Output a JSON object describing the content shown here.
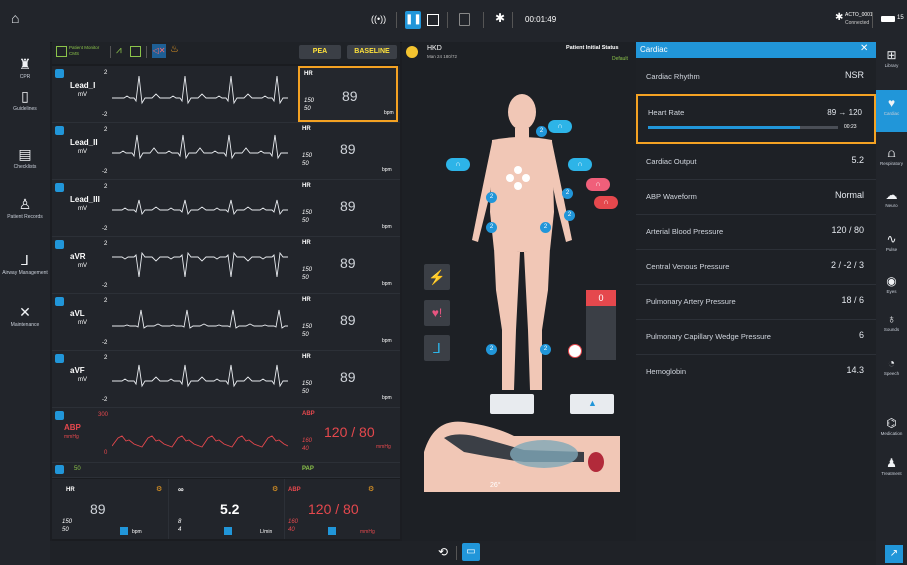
{
  "topbar": {
    "timer": "00:01:49",
    "bluetooth_device": "ACTO_0001",
    "bluetooth_status": "Connected",
    "battery_label": "15"
  },
  "left_nav": [
    {
      "label": "CPR",
      "icon": "person-cpr-icon"
    },
    {
      "label": "Guidelines",
      "icon": "book-icon"
    },
    {
      "label": "Checklists",
      "icon": "clipboard-icon"
    },
    {
      "label": "Patient Records",
      "icon": "user-record-icon"
    },
    {
      "label": "Airway Management",
      "icon": "airway-icon"
    },
    {
      "label": "Maintenance",
      "icon": "tools-icon"
    }
  ],
  "monitor": {
    "header": {
      "title": "Patient Monitor",
      "subtitle": "CMS",
      "pea_label": "PEA",
      "baseline_label": "BASELINE"
    },
    "leads": [
      {
        "name": "Lead_I",
        "unit": "mV",
        "top": "2",
        "bottom": "-2",
        "vital_label": "HR",
        "vital_value": "89",
        "hi": "150",
        "lo": "50",
        "vital_unit": "bpm"
      },
      {
        "name": "Lead_II",
        "unit": "mV",
        "top": "2",
        "bottom": "-2",
        "vital_label": "HR",
        "vital_value": "89",
        "hi": "150",
        "lo": "50",
        "vital_unit": "bpm"
      },
      {
        "name": "Lead_III",
        "unit": "mV",
        "top": "2",
        "bottom": "-2",
        "vital_label": "HR",
        "vital_value": "89",
        "hi": "150",
        "lo": "50",
        "vital_unit": "bpm"
      },
      {
        "name": "aVR",
        "unit": "mV",
        "top": "2",
        "bottom": "-2",
        "vital_label": "HR",
        "vital_value": "89",
        "hi": "150",
        "lo": "50",
        "vital_unit": "bpm"
      },
      {
        "name": "aVL",
        "unit": "mV",
        "top": "2",
        "bottom": "-2",
        "vital_label": "HR",
        "vital_value": "89",
        "hi": "150",
        "lo": "50",
        "vital_unit": "bpm"
      },
      {
        "name": "aVF",
        "unit": "mV",
        "top": "2",
        "bottom": "-2",
        "vital_label": "HR",
        "vital_value": "89",
        "hi": "150",
        "lo": "50",
        "vital_unit": "bpm"
      }
    ],
    "abp": {
      "name": "ABP",
      "unit": "mmHg",
      "top": "300",
      "bottom": "0",
      "vital_label": "ABP",
      "vital_value": "120 / 80",
      "hi": "160",
      "lo": "40",
      "vital_unit": "mmHg"
    },
    "pap": {
      "top": "50",
      "vital_label": "PAP"
    },
    "footer": {
      "hr": {
        "label": "HR",
        "value": "89",
        "hi": "150",
        "lo": "50",
        "unit": "bpm"
      },
      "co": {
        "label": "CO",
        "value": "5.2",
        "hi": "8",
        "lo": "4",
        "unit": "L/min"
      },
      "abp": {
        "label": "ABP",
        "value": "120 / 80",
        "hi": "160",
        "lo": "40",
        "unit": "mmHg"
      }
    }
  },
  "patient": {
    "name": "HKD",
    "details": "Man 24 180/72",
    "initial_status_label": "Patient Initial Status",
    "initial_status_value": "Default",
    "pressure_value": "0",
    "head_angle": "26°"
  },
  "cardiac_panel": {
    "title": "Cardiac",
    "rows": [
      {
        "label": "Cardiac Rhythm",
        "value": "NSR"
      },
      {
        "label": "Heart Rate",
        "value": "89 → 120",
        "timer": "00:23",
        "progress": 0.8
      },
      {
        "label": "Cardiac Output",
        "value": "5.2"
      },
      {
        "label": "ABP Waveform",
        "value": "Normal"
      },
      {
        "label": "Arterial Blood Pressure",
        "value": "120 / 80"
      },
      {
        "label": "Central Venous Pressure",
        "value": "2 / -2 / 3"
      },
      {
        "label": "Pulmonary Artery Pressure",
        "value": "18 / 6"
      },
      {
        "label": "Pulmonary Capillary Wedge Pressure",
        "value": "6"
      },
      {
        "label": "Hemoglobin",
        "value": "14.3"
      }
    ]
  },
  "right_nav": [
    {
      "label": "Library",
      "icon": "library-icon"
    },
    {
      "label": "Cardiac",
      "icon": "heart-icon"
    },
    {
      "label": "Respiratory",
      "icon": "lungs-icon"
    },
    {
      "label": "Neuro",
      "icon": "brain-icon"
    },
    {
      "label": "Pulse",
      "icon": "pulse-icon"
    },
    {
      "label": "Eyes",
      "icon": "eye-icon"
    },
    {
      "label": "Sounds",
      "icon": "stethoscope-icon"
    },
    {
      "label": "Speech",
      "icon": "speech-icon"
    },
    {
      "label": "Medication",
      "icon": "medication-icon"
    },
    {
      "label": "Treatment",
      "icon": "treatment-icon"
    }
  ],
  "colors": {
    "accent": "#2196d9",
    "highlight": "#f4a223",
    "abp_red": "#e5484d",
    "bar_yellow": "#ffe23b"
  }
}
